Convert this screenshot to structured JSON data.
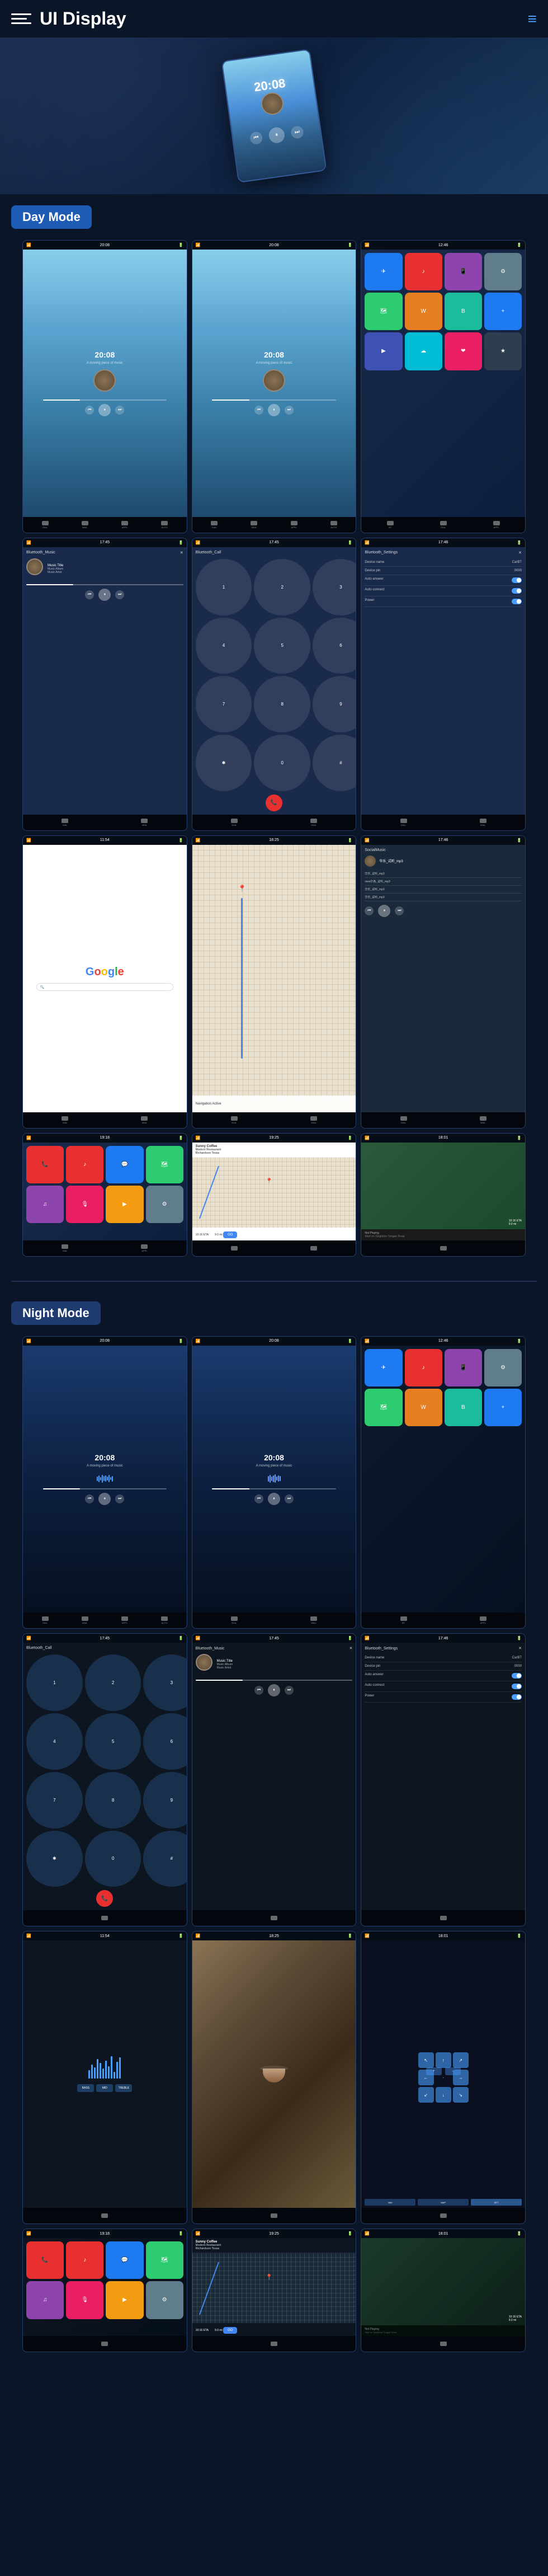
{
  "header": {
    "title": "UI Display",
    "menu_icon": "menu",
    "hamburger_icon": "≡"
  },
  "day_mode": {
    "label": "Day Mode"
  },
  "night_mode": {
    "label": "Night Mode"
  },
  "music_screens": {
    "time": "20:08",
    "music_title": "Music Title",
    "music_album": "Music Album",
    "music_artist": "Music Artist",
    "bluetooth_music": "Bluetooth_Music",
    "bluetooth_call": "Bluetooth_Call",
    "bluetooth_settings": "Bluetooth_Settings"
  },
  "bluetooth_settings": {
    "device_name_label": "Device name",
    "device_name_value": "CarBT",
    "device_pin_label": "Device pin",
    "device_pin_value": "0000",
    "auto_answer_label": "Auto answer",
    "auto_connect_label": "Auto connect",
    "power_label": "Power"
  },
  "nav": {
    "google_label": "Google",
    "coffee_shop": "Sunny Coffee",
    "restaurant_label": "Modern Restaurant",
    "address": "Richardson Texas",
    "eta_label": "10:16 ETA",
    "distance": "9.0 mi",
    "go_label": "GO",
    "not_playing": "Not Playing",
    "start_label": "Start on Singleton-Tongue Road"
  },
  "local_music": {
    "header": "SocialMusic",
    "files": [
      "华乐_试听_mp3",
      "view尔各_试听_mp3",
      "华乐_试听_mp3",
      "华乐_试听_mp3"
    ]
  },
  "keypad_digits": [
    "1",
    "2",
    "3",
    "4",
    "5",
    "6",
    "7",
    "8",
    "9",
    "✱",
    "0",
    "#"
  ],
  "nav_arrows": [
    "↖",
    "↑",
    "↗",
    "←",
    "·",
    "→",
    "↙",
    "↓",
    "↘"
  ]
}
